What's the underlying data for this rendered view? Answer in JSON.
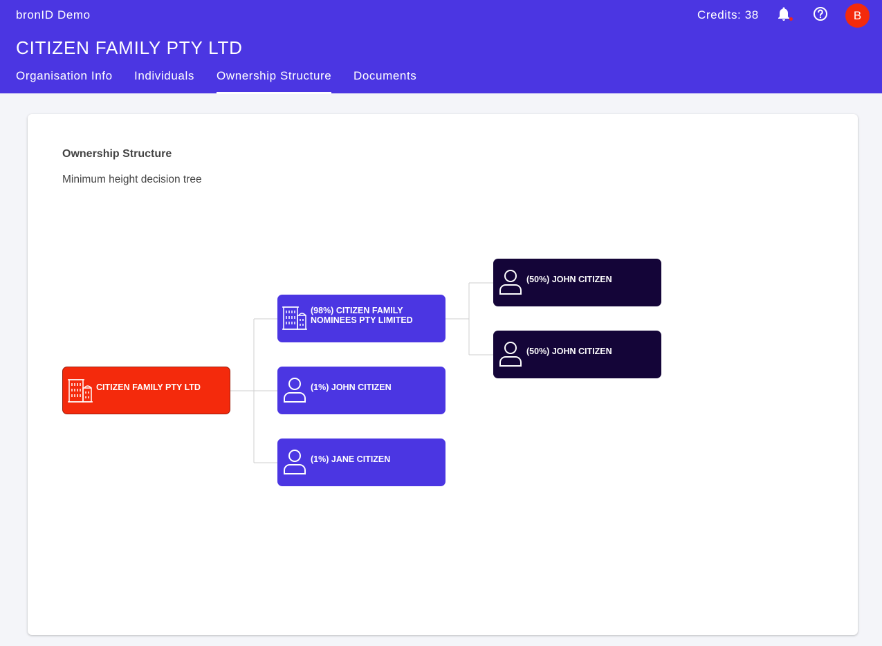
{
  "header": {
    "app_name": "bronID Demo",
    "credits": "Credits: 38",
    "avatar_initial": "B",
    "org_title": "CITIZEN FAMILY PTY LTD"
  },
  "tabs": [
    {
      "label": "Organisation Info",
      "active": false
    },
    {
      "label": "Individuals",
      "active": false
    },
    {
      "label": "Ownership Structure",
      "active": true
    },
    {
      "label": "Documents",
      "active": false
    }
  ],
  "card": {
    "title": "Ownership Structure",
    "subtitle": "Minimum height decision tree"
  },
  "tree": {
    "root": {
      "label": "CITIZEN FAMILY PTY LTD",
      "icon": "building-icon"
    },
    "children": [
      {
        "label": "(98%) CITIZEN FAMILY NOMINEES PTY LIMITED",
        "icon": "building-icon"
      },
      {
        "label": "(1%) JOHN CITIZEN",
        "icon": "person-icon"
      },
      {
        "label": "(1%) JANE CITIZEN",
        "icon": "person-icon"
      }
    ],
    "grandchildren": [
      {
        "label": "(50%) JOHN CITIZEN",
        "icon": "person-icon"
      },
      {
        "label": "(50%) JOHN CITIZEN",
        "icon": "person-icon"
      }
    ]
  },
  "colors": {
    "brand": "#4b36e2",
    "root_node": "#f42a0c",
    "leaf_node": "#140538",
    "notification_dot": "#f0251b"
  }
}
